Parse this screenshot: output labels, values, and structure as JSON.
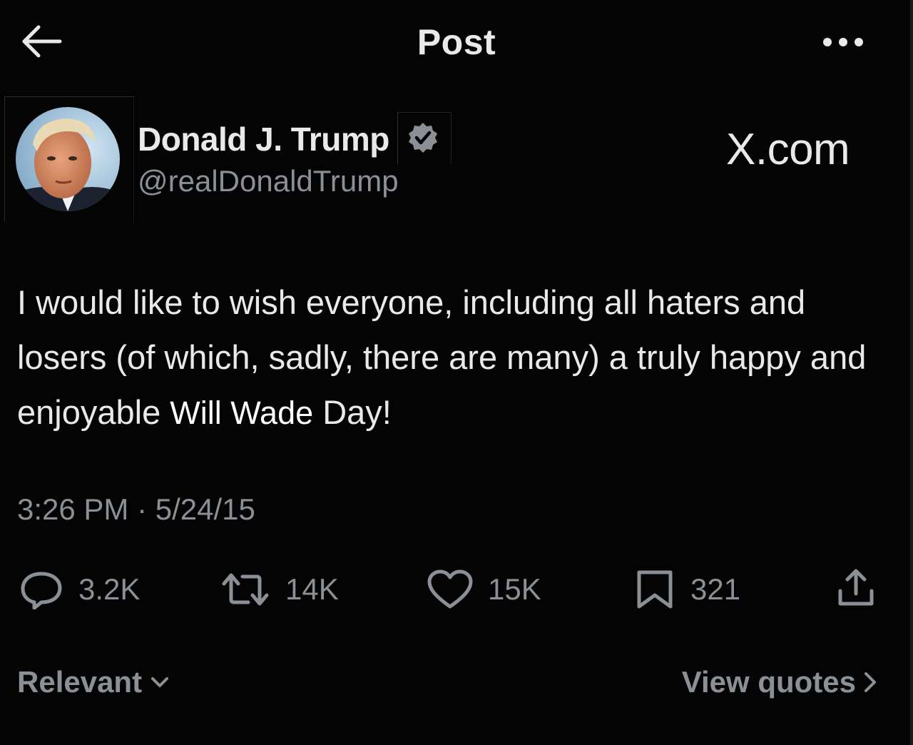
{
  "header": {
    "title": "Post",
    "back_icon": "arrow-left-icon",
    "more_icon": "more-horizontal-icon"
  },
  "author": {
    "name": "Donald J. Trump",
    "handle": "@realDonaldTrump",
    "verified": true,
    "verified_color": "#8b9096",
    "avatar_icon": "avatar-photo"
  },
  "site_label": "X.com",
  "post": {
    "text_before": "I would like to wish everyone, including all haters and losers (of which, sadly, there are many) a truly happy and enjoyable ",
    "inserted_name": "Will Wade",
    "text_after": " Day!"
  },
  "timestamp": "3:26 PM · 5/24/15",
  "actions": {
    "replies": "3.2K",
    "reposts": "14K",
    "likes": "15K",
    "bookmarks": "321"
  },
  "footer": {
    "sort_label": "Relevant",
    "quotes_label": "View quotes"
  },
  "colors": {
    "background": "#040404",
    "text_primary": "#e7e9ea",
    "text_secondary": "#8b9096"
  }
}
